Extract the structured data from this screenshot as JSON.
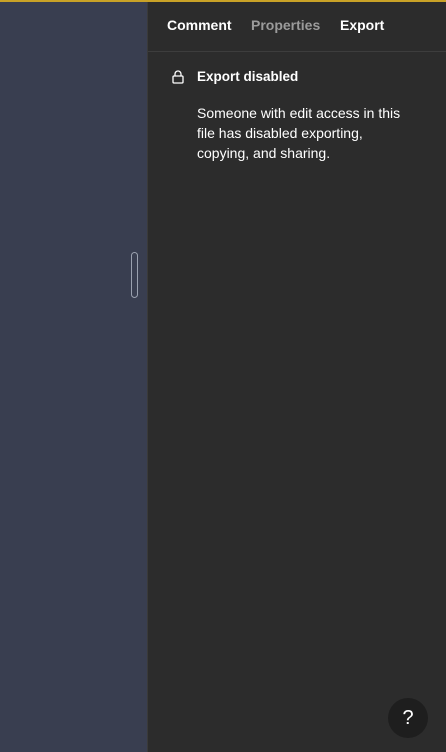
{
  "tabs": {
    "comment": "Comment",
    "properties": "Properties",
    "export": "Export"
  },
  "notice": {
    "icon": "lock-icon",
    "title": "Export disabled",
    "body": "Someone with edit access in this file has disabled exporting, copying, and sharing."
  },
  "help": {
    "label": "?"
  },
  "colors": {
    "canvas": "#393e50",
    "panel": "#2c2c2c",
    "accent": "#c9a227",
    "inactive_tab": "#9b9b9b"
  }
}
